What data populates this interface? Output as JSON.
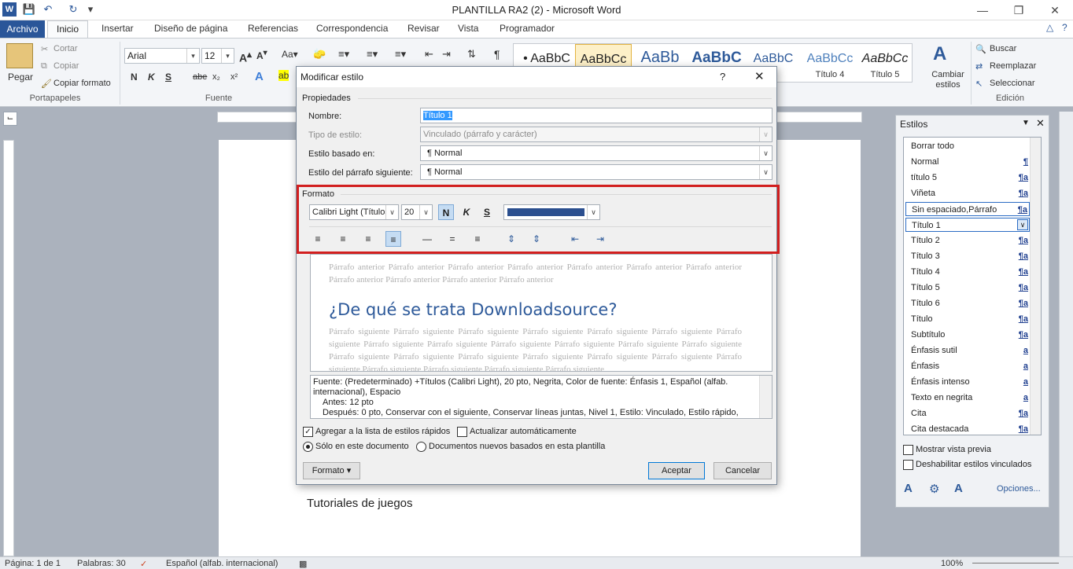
{
  "window": {
    "title": "PLANTILLA RA2 (2)  -  Microsoft Word"
  },
  "tabs": [
    "Archivo",
    "Inicio",
    "Insertar",
    "Diseño de página",
    "Referencias",
    "Correspondencia",
    "Revisar",
    "Vista",
    "Programador"
  ],
  "ribbon": {
    "clipboard": {
      "paste": "Pegar",
      "cut": "Cortar",
      "copy": "Copiar",
      "format_painter": "Copiar formato",
      "label": "Portapapeles"
    },
    "font": {
      "name": "Arial",
      "size": "12",
      "label": "Fuente",
      "bold": "N",
      "italic": "K",
      "underline": "S",
      "strike": "abe",
      "sub": "x₂",
      "sup": "x²"
    },
    "styles_gallery": [
      {
        "sample": "• AaBbC",
        "label": ""
      },
      {
        "sample": "AaBbCc",
        "label": ""
      },
      {
        "sample": "AaBb",
        "label": ""
      },
      {
        "sample": "AaBbC",
        "label": ""
      },
      {
        "sample": "AaBbC",
        "label": "3"
      },
      {
        "sample": "AaBbCc",
        "label": "Título 4"
      },
      {
        "sample": "AaBbCc",
        "label": "Título 5"
      }
    ],
    "change_styles": "Cambiar estilos",
    "editing": {
      "find": "Buscar",
      "replace": "Reemplazar",
      "select": "Seleccionar",
      "label": "Edición"
    }
  },
  "document": {
    "visible_text": "Tutoriales de juegos"
  },
  "dialog": {
    "title": "Modificar estilo",
    "help": "?",
    "properties_label": "Propiedades",
    "name_label": "Nombre:",
    "name_value": "Título 1",
    "style_type_label": "Tipo de estilo:",
    "style_type_value": "Vinculado (párrafo y carácter)",
    "based_on_label": "Estilo basado en:",
    "based_on_value": "¶ Normal",
    "next_label": "Estilo del párrafo siguiente:",
    "next_value": "¶ Normal",
    "format_label": "Formato",
    "font": "Calibri Light (Títulos",
    "size": "20",
    "bold": "N",
    "italic": "K",
    "underline": "S",
    "font_color": "#2b4f8f",
    "preview_before": "Párrafo anterior Párrafo anterior Párrafo anterior Párrafo anterior Párrafo anterior Párrafo anterior Párrafo anterior Párrafo anterior Párrafo anterior Párrafo anterior Párrafo anterior",
    "preview_heading": "¿De qué se trata Downloadsource?",
    "preview_after": "Párrafo siguiente Párrafo siguiente Párrafo siguiente Párrafo siguiente Párrafo siguiente Párrafo siguiente Párrafo siguiente Párrafo siguiente Párrafo siguiente Párrafo siguiente Párrafo siguiente Párrafo siguiente Párrafo siguiente Párrafo siguiente Párrafo siguiente Párrafo siguiente Párrafo siguiente Párrafo siguiente Párrafo siguiente Párrafo siguiente Párrafo siguiente Párrafo siguiente Párrafo siguiente Párrafo siguiente",
    "description_1": "Fuente: (Predeterminado) +Títulos (Calibri Light), 20 pto, Negrita, Color de fuente: Énfasis 1, Español (alfab. internacional), Espacio",
    "description_2": "Antes:  12 pto",
    "description_3": "Después:  0 pto, Conservar con el siguiente, Conservar líneas juntas, Nivel 1, Estilo: Vinculado, Estilo rápido,",
    "add_quick": "Agregar a la lista de estilos rápidos",
    "auto_update": "Actualizar automáticamente",
    "only_doc": "Sólo en este documento",
    "new_docs": "Documentos nuevos basados en esta plantilla",
    "format_button": "Formato ▾",
    "ok": "Aceptar",
    "cancel": "Cancelar"
  },
  "styles_pane": {
    "title": "Estilos",
    "items": [
      {
        "name": "Borrar todo",
        "mark": ""
      },
      {
        "name": "Normal",
        "mark": "¶"
      },
      {
        "name": "título 5",
        "mark": "¶a"
      },
      {
        "name": "Viñeta",
        "mark": "¶a"
      },
      {
        "name": "Sin espaciado,Párrafo",
        "mark": "¶a"
      },
      {
        "name": "Título 1",
        "mark": ""
      },
      {
        "name": "Título 2",
        "mark": "¶a"
      },
      {
        "name": "Título 3",
        "mark": "¶a"
      },
      {
        "name": "Título 4",
        "mark": "¶a"
      },
      {
        "name": "Título 5",
        "mark": "¶a"
      },
      {
        "name": "Título 6",
        "mark": "¶a"
      },
      {
        "name": "Título",
        "mark": "¶a"
      },
      {
        "name": "Subtítulo",
        "mark": "¶a"
      },
      {
        "name": "Énfasis sutil",
        "mark": "a"
      },
      {
        "name": "Énfasis",
        "mark": "a"
      },
      {
        "name": "Énfasis intenso",
        "mark": "a"
      },
      {
        "name": "Texto en negrita",
        "mark": "a"
      },
      {
        "name": "Cita",
        "mark": "¶a"
      },
      {
        "name": "Cita destacada",
        "mark": "¶a"
      }
    ],
    "show_preview": "Mostrar vista previa",
    "disable_linked": "Deshabilitar estilos vinculados",
    "options": "Opciones..."
  },
  "status": {
    "page": "Página: 1 de 1",
    "words": "Palabras: 30",
    "language": "Español (alfab. internacional)",
    "zoom": "100%"
  }
}
